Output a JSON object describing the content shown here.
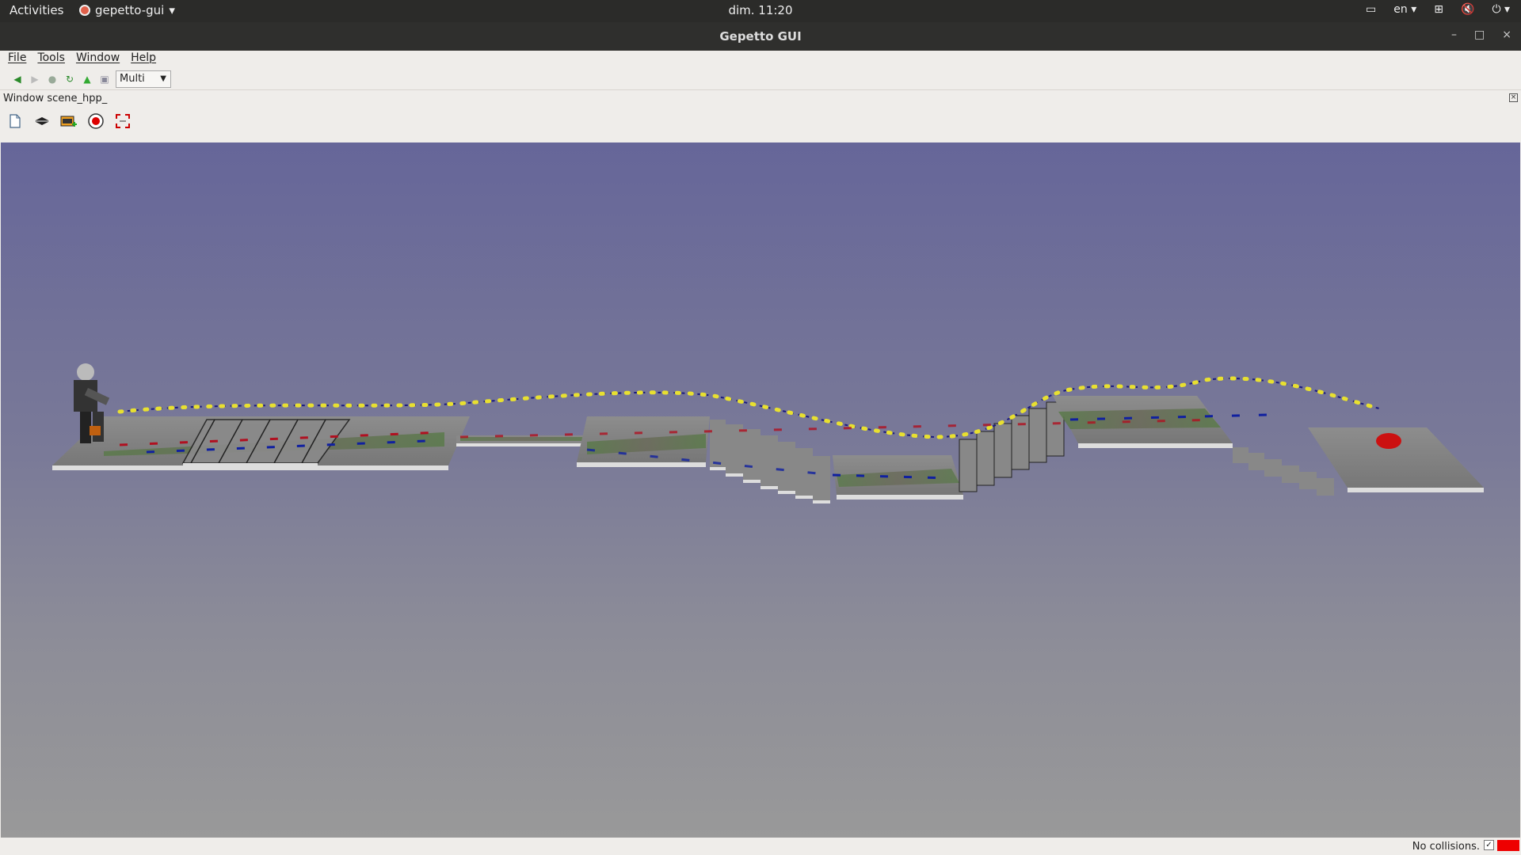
{
  "topbar": {
    "activities": "Activities",
    "app_name": "gepetto-gui",
    "clock": "dim. 11:20",
    "lang": "en"
  },
  "window": {
    "title": "Gepetto GUI"
  },
  "menu": {
    "file": "File",
    "tools": "Tools",
    "window": "Window",
    "help": "Help"
  },
  "toolbar": {
    "mode_select": "Multi"
  },
  "scene": {
    "window_label": "Window scene_hpp_"
  },
  "status": {
    "text": "No collisions.",
    "check": "✓",
    "indicator_color": "#ee0000"
  },
  "colors": {
    "viewport_top": "#666699",
    "viewport_bottom": "#999999"
  }
}
